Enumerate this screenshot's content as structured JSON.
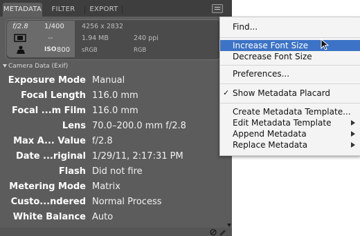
{
  "tabs": [
    {
      "label": "METADATA",
      "active": true
    },
    {
      "label": "FILTER",
      "active": false
    },
    {
      "label": "EXPORT",
      "active": false
    }
  ],
  "placard": {
    "aperture": "f/2.8",
    "shutter": "1/400",
    "dash": "--",
    "iso_label": "ISO",
    "iso": "800",
    "dimensions": "4256 x 2832",
    "size": "1.94 MB",
    "ppi": "240 ppi",
    "profile": "sRGB",
    "mode": "RGB"
  },
  "section": {
    "title": "Camera Data (Exif)"
  },
  "rows": [
    {
      "label": "Exposure Mode",
      "value": "Manual"
    },
    {
      "label": "Focal Length",
      "value": "116.0 mm"
    },
    {
      "label": "Focal ...m Film",
      "value": "116.0 mm"
    },
    {
      "label": "Lens",
      "value": "70.0–200.0 mm f/2.8"
    },
    {
      "label": "Max A... Value",
      "value": "f/2.8"
    },
    {
      "label": "Date ...riginal",
      "value": "1/29/11, 2:17:31 PM"
    },
    {
      "label": "Flash",
      "value": "Did not fire"
    },
    {
      "label": "Metering Mode",
      "value": "Matrix"
    },
    {
      "label": "Custo...ndered",
      "value": "Normal Process"
    },
    {
      "label": "White Balance",
      "value": "Auto"
    }
  ],
  "menu": {
    "find": "Find...",
    "increase": "Increase Font Size",
    "decrease": "Decrease Font Size",
    "preferences": "Preferences...",
    "check_mark": "✓",
    "show_placard": "Show Metadata Placard",
    "create_template": "Create Metadata Template...",
    "edit_template": "Edit Metadata Template",
    "append": "Append Metadata",
    "replace": "Replace Metadata"
  },
  "colors": {
    "panel": "#5c5c5c",
    "highlight": "#3c73c6",
    "menu_bg": "#f4f4f4"
  }
}
